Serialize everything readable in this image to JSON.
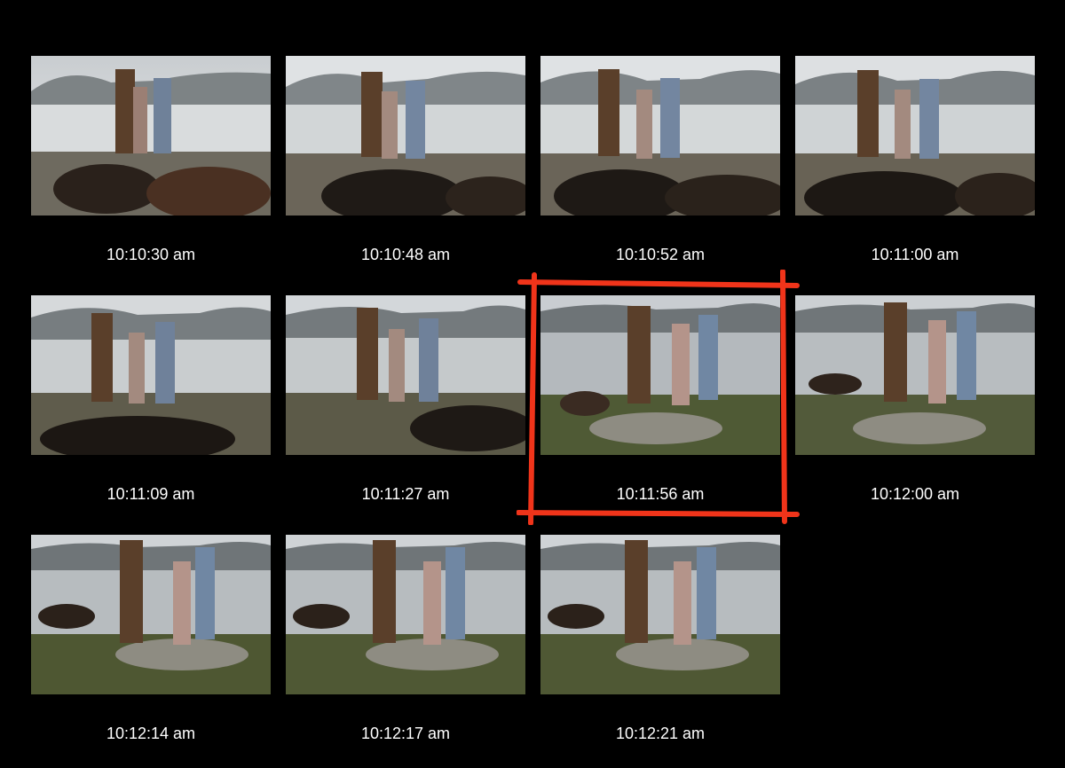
{
  "sheet": {
    "frames": [
      {
        "time": "10:10:30 am",
        "selected": false
      },
      {
        "time": "10:10:48 am",
        "selected": false
      },
      {
        "time": "10:10:52 am",
        "selected": false
      },
      {
        "time": "10:11:00 am",
        "selected": false
      },
      {
        "time": "10:11:09 am",
        "selected": false
      },
      {
        "time": "10:11:27 am",
        "selected": false
      },
      {
        "time": "10:11:56 am",
        "selected": true
      },
      {
        "time": "10:12:00 am",
        "selected": false
      },
      {
        "time": "10:12:14 am",
        "selected": false
      },
      {
        "time": "10:12:17 am",
        "selected": false
      },
      {
        "time": "10:12:21 am",
        "selected": false
      }
    ],
    "marker_color": "#f0341a"
  }
}
